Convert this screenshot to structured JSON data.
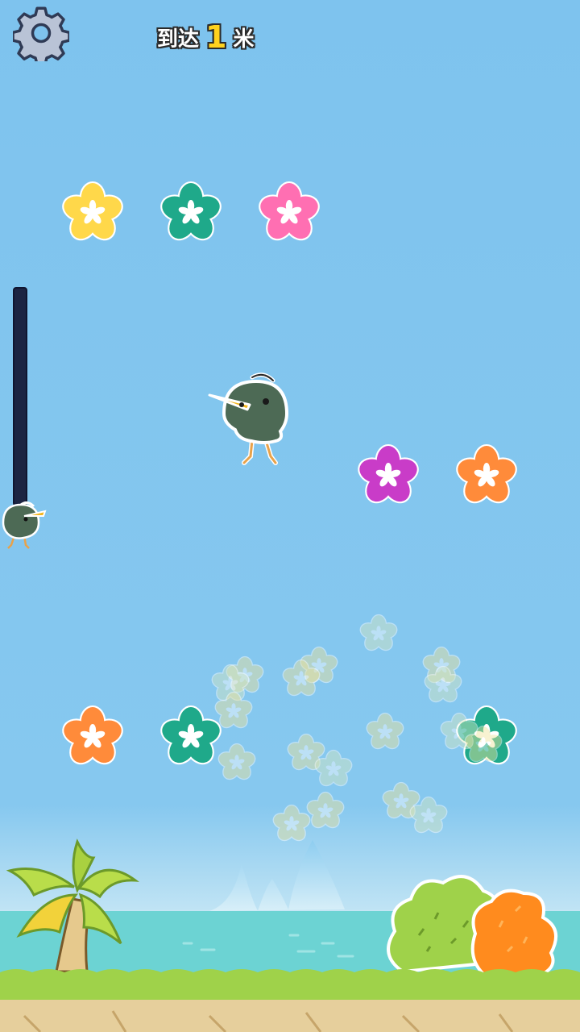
{
  "hud": {
    "settings_icon": "gear-icon",
    "distance_prefix": "到达",
    "distance_value": "1",
    "distance_unit": "米"
  },
  "progress_meter": {
    "fill_fraction": 0.0
  },
  "colors": {
    "sky": "#7ec3ee",
    "flower_yellow": "#ffd84a",
    "flower_teal": "#1fa98a",
    "flower_pink": "#ff6fb2",
    "flower_purple": "#c93cc8",
    "flower_orange": "#ff8b3a",
    "kiwi_body": "#4d6a55",
    "kiwi_beak": "#f2b51f",
    "sea": "#6cd3d3",
    "grass": "#9fd24a",
    "dirt": "#e6cf9c"
  },
  "flowers": [
    {
      "color": "flower_yellow"
    },
    {
      "color": "flower_teal"
    },
    {
      "color": "flower_pink"
    },
    {
      "color": "flower_purple"
    },
    {
      "color": "flower_orange"
    },
    {
      "color": "flower_orange"
    },
    {
      "color": "flower_teal"
    },
    {
      "color": "flower_teal"
    }
  ]
}
